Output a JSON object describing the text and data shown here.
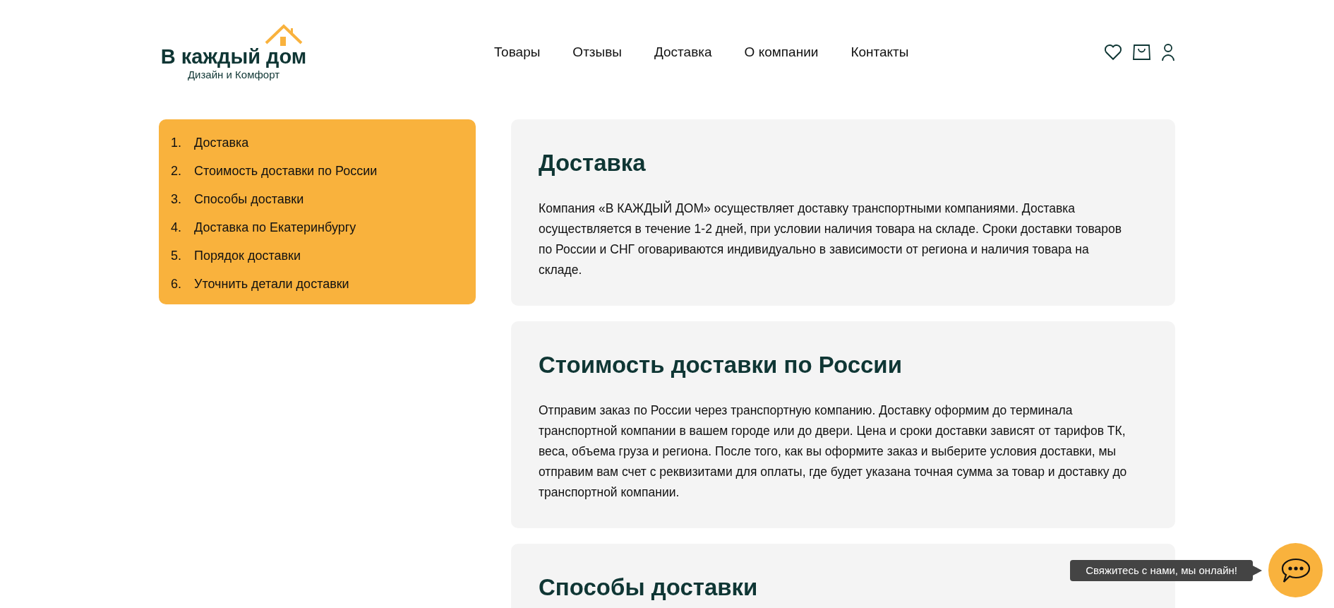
{
  "logo": {
    "title": "В каждый дом",
    "subtitle": "Дизайн и Комфорт"
  },
  "nav": [
    "Товары",
    "Отзывы",
    "Доставка",
    "О компании",
    "Контакты"
  ],
  "toc": [
    {
      "number": "1.",
      "label": "Доставка"
    },
    {
      "number": "2.",
      "label": "Стоимость доставки по России"
    },
    {
      "number": "3.",
      "label": "Способы доставки"
    },
    {
      "number": "4.",
      "label": "Доставка по Екатеринбургу"
    },
    {
      "number": "5.",
      "label": "Порядок доставки"
    },
    {
      "number": "6.",
      "label": "Уточнить детали доставки"
    }
  ],
  "sections": [
    {
      "title": "Доставка",
      "text": "Компания «В КАЖДЫЙ ДОМ» осуществляет доставку транспортными компаниями. Доставка осуществляется в течение 1-2 дней, при условии наличия товара на складе. Сроки доставки товаров по России и СНГ оговариваются индивидуально в зависимости от региона и наличия товара на складе."
    },
    {
      "title": "Стоимость доставки по России",
      "text": "Отправим заказ по России через транспортную компанию. Доставку оформим до терминала транспортной компании в вашем городе или до двери. Цена и сроки доставки зависят от тарифов ТК, веса, объема груза и региона. После того, как вы оформите заказ и выберите условия доставки, мы отправим вам счет с реквизитами для оплаты, где будет указана точная сумма за товар и доставку до транспортной компании."
    },
    {
      "title": "Способы доставки"
    }
  ],
  "chat": {
    "tooltip": "Свяжитесь с нами, мы онлайн!"
  }
}
